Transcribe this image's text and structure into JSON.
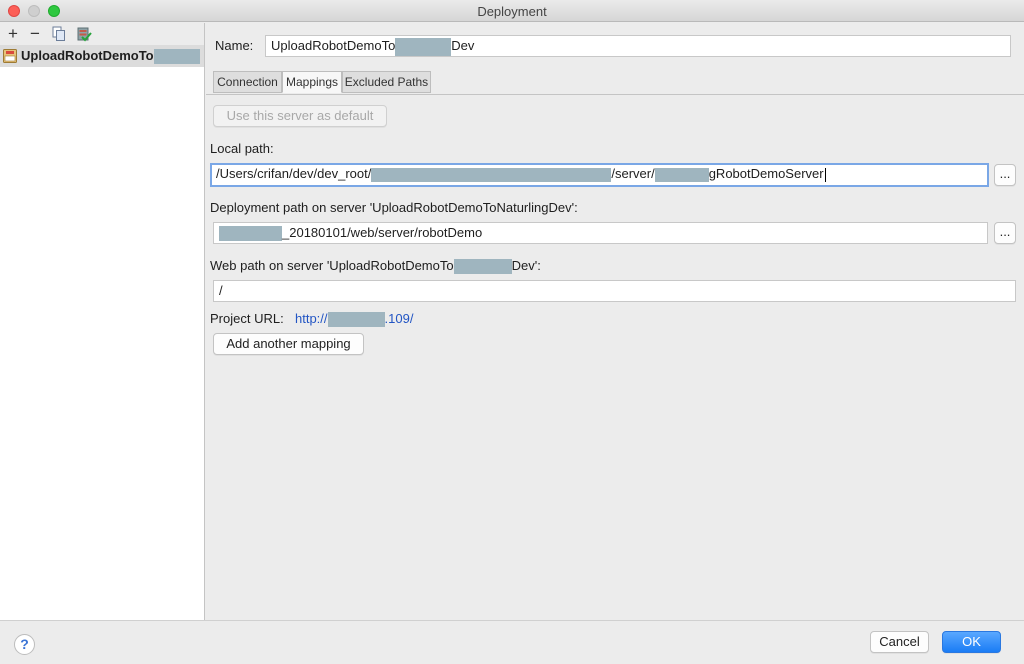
{
  "window": {
    "title": "Deployment"
  },
  "toolbar": {
    "add_label": "+",
    "remove_label": "−"
  },
  "tree": {
    "items": [
      {
        "label": "UploadRobotDemoTo",
        "selected": true
      }
    ]
  },
  "form": {
    "name_label": "Name:",
    "name_value_prefix": "UploadRobotDemoTo",
    "name_value_suffix": "Dev"
  },
  "tabs": [
    {
      "label": "Connection",
      "active": false
    },
    {
      "label": "Mappings",
      "active": true
    },
    {
      "label": "Excluded Paths",
      "active": false
    }
  ],
  "mappings": {
    "default_button": "Use this server as default",
    "local_path_label": "Local path:",
    "local_path_part1": "/Users/crifan/dev/dev_root/",
    "local_path_part2": "/server/",
    "local_path_part3": "gRobotDemoServer",
    "deployment_path_label": "Deployment path on server 'UploadRobotDemoToNaturlingDev':",
    "deployment_path_suffix": "_20180101/web/server/robotDemo",
    "web_path_label_prefix": "Web path on server 'UploadRobotDemoTo",
    "web_path_label_suffix": "Dev':",
    "web_path_value": "/",
    "project_url_label": "Project URL:",
    "project_url_prefix": "http://",
    "project_url_suffix": ".109/",
    "add_mapping_button": "Add another mapping",
    "browse_label": "..."
  },
  "footer": {
    "help_label": "?",
    "cancel_label": "Cancel",
    "ok_label": "OK"
  },
  "colors": {
    "accent": "#1a7cf5",
    "link": "#2255c4",
    "redaction": "#9fb5bf"
  }
}
